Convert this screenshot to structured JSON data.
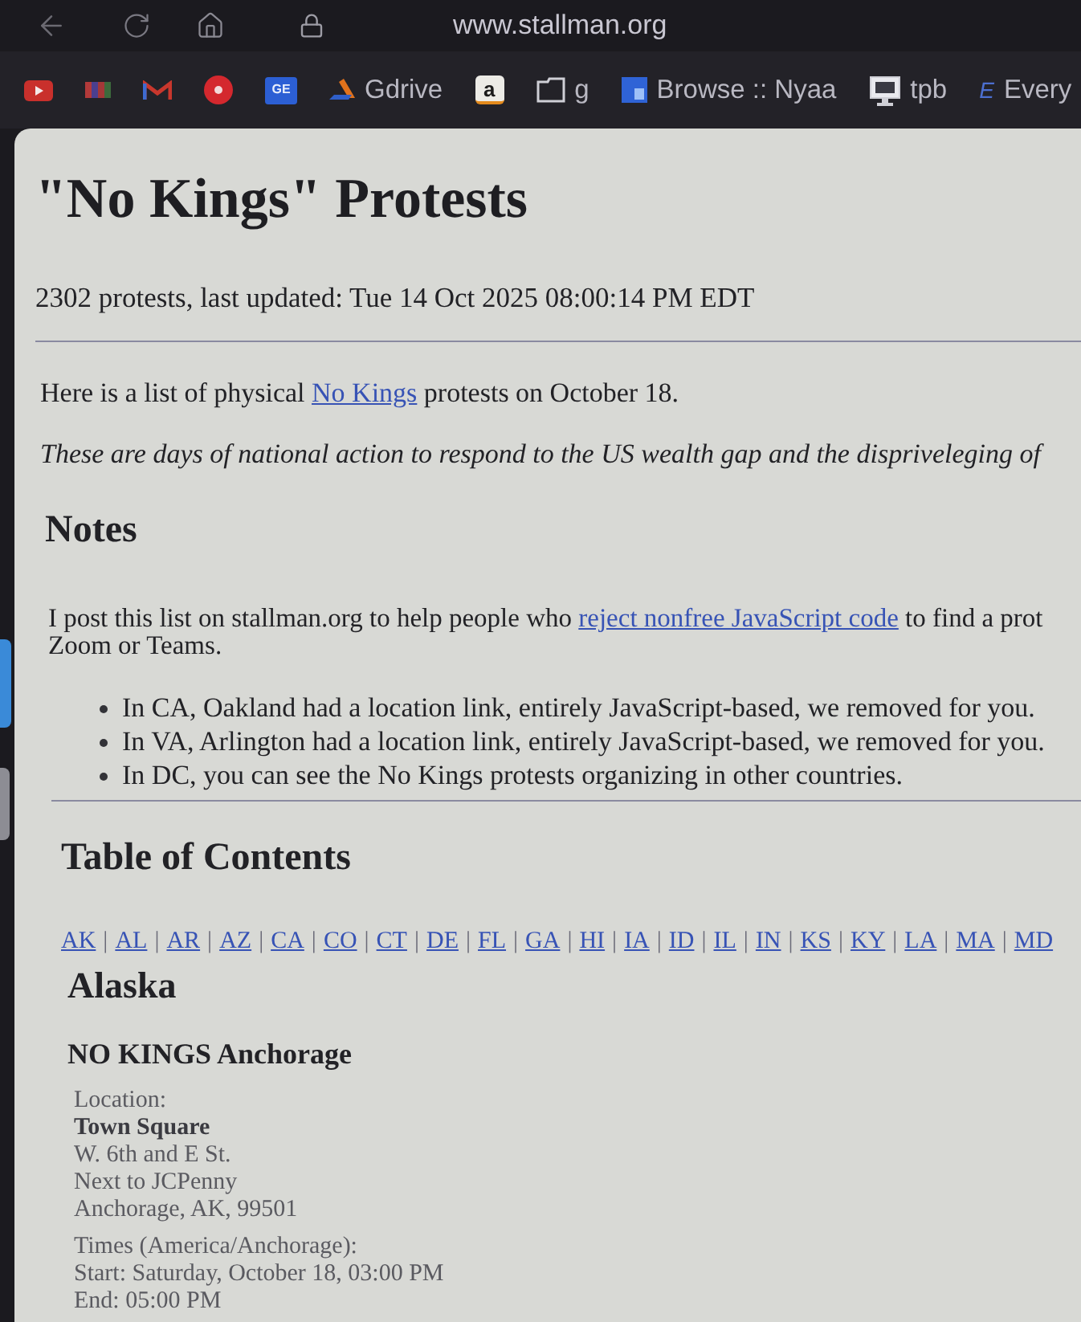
{
  "browser": {
    "url": "www.stallman.org",
    "bookmarks": [
      {
        "kind": "play"
      },
      {
        "kind": "bars"
      },
      {
        "kind": "mail"
      },
      {
        "kind": "disc"
      },
      {
        "kind": "tile",
        "glyph": "GE"
      },
      {
        "kind": "drive",
        "label": "Gdrive"
      },
      {
        "kind": "light_tile",
        "glyph": "a"
      },
      {
        "kind": "folder",
        "label": "g"
      },
      {
        "kind": "page",
        "label": "Browse :: Nyaa"
      },
      {
        "kind": "monitor",
        "label": "tpb"
      },
      {
        "kind": "letter",
        "glyph": "E",
        "label": "Every"
      }
    ]
  },
  "page": {
    "title": "\"No Kings\" Protests",
    "updated": "2302 protests, last updated: Tue 14 Oct 2025 08:00:14 PM EDT",
    "intro": {
      "before": "Here is a list of physical ",
      "link": "No Kings",
      "after": " protests on October 18."
    },
    "tagline": "These are days of national action to respond to the US wealth gap and the dispriveleging of",
    "notes": {
      "heading": "Notes",
      "paragraph": {
        "before": "I post this list on stallman.org to help people who ",
        "link": "reject nonfree JavaScript code",
        "after": " to find a prot",
        "continuation": "Zoom or Teams."
      },
      "bullets": [
        "In CA, Oakland had a location link, entirely JavaScript-based, we removed for you.",
        "In VA, Arlington had a location link, entirely JavaScript-based, we removed for you.",
        "In DC, you can see the No Kings protests organizing in other countries."
      ]
    },
    "toc": {
      "heading": "Table of Contents",
      "separator": "|",
      "links": [
        "AK",
        "AL",
        "AR",
        "AZ",
        "CA",
        "CO",
        "CT",
        "DE",
        "FL",
        "GA",
        "HI",
        "IA",
        "ID",
        "IL",
        "IN",
        "KS",
        "KY",
        "LA",
        "MA",
        "MD"
      ]
    },
    "sections": [
      {
        "heading": "Alaska",
        "events": [
          {
            "title": "NO KINGS Anchorage",
            "location_label": "Location:",
            "venue": "Town Square",
            "address_lines": [
              "W. 6th and E St.",
              "Next to JCPenny",
              "Anchorage, AK, 99501"
            ],
            "times_label": "Times (America/Anchorage):",
            "start": "Start: Saturday, October 18, 03:00 PM",
            "end": "End: 05:00 PM"
          }
        ]
      }
    ]
  }
}
